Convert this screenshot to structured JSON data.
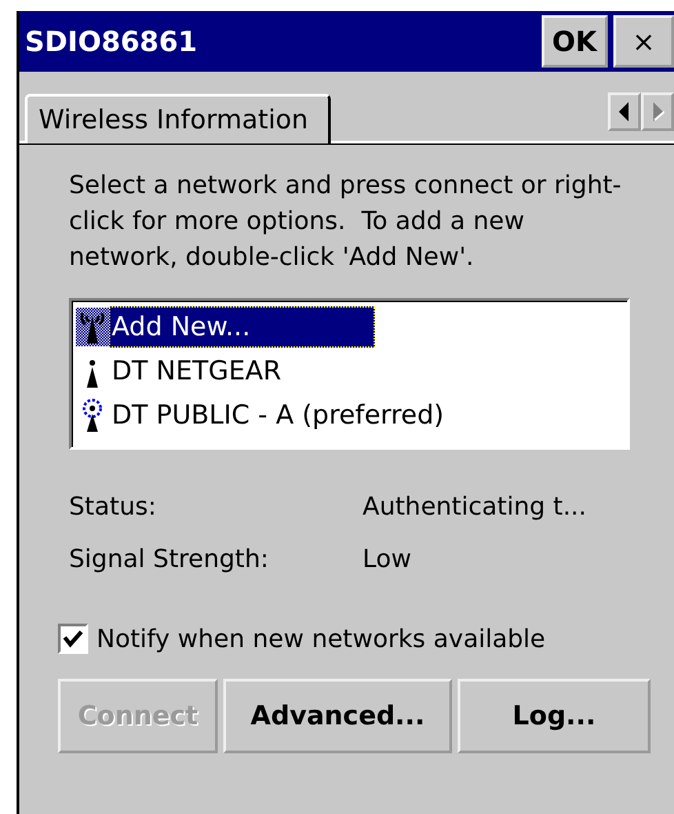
{
  "window": {
    "title": "SDIO86861",
    "ok_button": "OK",
    "close_button": "×"
  },
  "tabs": [
    {
      "label": "Wireless Information",
      "selected": true
    }
  ],
  "tab_scroll": [
    {
      "kind": "left",
      "disabled": false
    },
    {
      "kind": "right",
      "disabled": true
    }
  ],
  "instructions": "Select a network and press connect or right-click for more options.  To add a new network, double-click 'Add New'.",
  "networks": [
    {
      "name": "Add New...",
      "kind": "add",
      "selected": true
    },
    {
      "name": "DT NETGEAR",
      "kind": "network",
      "selected": false
    },
    {
      "name": "DT PUBLIC - A (preferred)",
      "kind": "preferred",
      "selected": false
    }
  ],
  "info": [
    {
      "label": "Status:",
      "value": "Authenticating t..."
    },
    {
      "label": "Signal Strength:",
      "value": "Low"
    }
  ],
  "notify": {
    "label": "Notify when new networks available",
    "checked": true
  },
  "buttons": [
    {
      "label": "Connect",
      "disabled": true
    },
    {
      "label": "Advanced...",
      "disabled": false
    },
    {
      "label": "Log...",
      "disabled": false
    }
  ]
}
